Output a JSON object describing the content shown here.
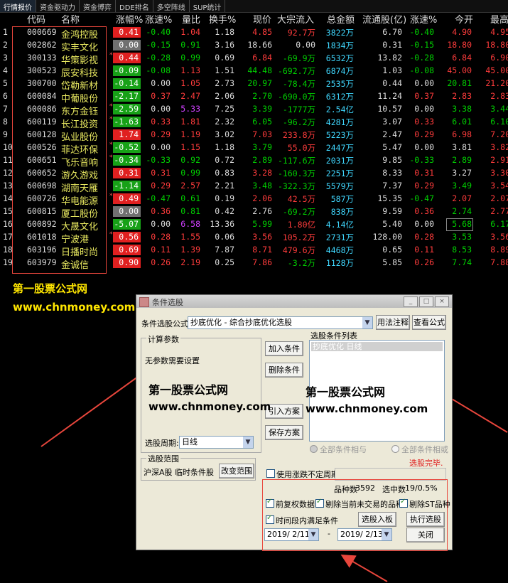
{
  "tabs": [
    "行情报价",
    "资金驱动力",
    "资金博弈",
    "DDE排名",
    "多空阵线",
    "SUP统计"
  ],
  "headers": {
    "code": "代码",
    "name": "名称",
    "pct": "涨幅%",
    "speed": "涨速%",
    "volratio": "量比",
    "turnover": "换手%",
    "price": "现价",
    "bigflow": "大宗流入",
    "amount": "总金额",
    "float": "流通股(亿)",
    "speed2": "涨速%",
    "open": "今开",
    "high": "最高"
  },
  "rows": [
    {
      "i": "1",
      "code": "000669",
      "name": "金鸿控股",
      "star": false,
      "pct": "0.41",
      "pc": "r",
      "speed": "-0.40",
      "sc": "g",
      "vol": "1.04",
      "vc": "r",
      "turn": "1.18",
      "price": "4.85",
      "prc": "r",
      "flow": "92.7万",
      "fc": "r",
      "amt": "3822万",
      "flt": "6.70",
      "sp2": "-0.40",
      "s2c": "g",
      "open": "4.90",
      "oc": "r",
      "high": "4.95",
      "hc": "r"
    },
    {
      "i": "2",
      "code": "002862",
      "name": "实丰文化",
      "star": false,
      "pct": "0.00",
      "pc": "w",
      "speed": "-0.15",
      "sc": "g",
      "vol": "0.91",
      "vc": "g",
      "turn": "3.16",
      "price": "18.66",
      "prc": "w",
      "flow": "0.00",
      "fc": "w",
      "amt": "1834万",
      "flt": "0.31",
      "sp2": "-0.15",
      "s2c": "g",
      "open": "18.80",
      "oc": "r",
      "high": "18.80",
      "hc": "r"
    },
    {
      "i": "3",
      "code": "300133",
      "name": "华策影视",
      "star": true,
      "pct": "0.44",
      "pc": "r",
      "speed": "-0.28",
      "sc": "g",
      "vol": "0.99",
      "vc": "g",
      "turn": "0.69",
      "price": "6.84",
      "prc": "r",
      "flow": "-69.9万",
      "fc": "g",
      "amt": "6532万",
      "flt": "13.82",
      "sp2": "-0.28",
      "s2c": "g",
      "open": "6.84",
      "oc": "r",
      "high": "6.90",
      "hc": "r"
    },
    {
      "i": "4",
      "code": "300523",
      "name": "辰安科技",
      "star": false,
      "pct": "-0.09",
      "pc": "g",
      "speed": "-0.08",
      "sc": "g",
      "vol": "1.13",
      "vc": "r",
      "turn": "1.51",
      "price": "44.48",
      "prc": "g",
      "flow": "-692.7万",
      "fc": "g",
      "amt": "6874万",
      "flt": "1.03",
      "sp2": "-0.08",
      "s2c": "g",
      "open": "45.00",
      "oc": "r",
      "high": "45.00",
      "hc": "r"
    },
    {
      "i": "5",
      "code": "300700",
      "name": "岱勒新材",
      "star": false,
      "pct": "-0.14",
      "pc": "g",
      "speed": "0.00",
      "sc": "w",
      "vol": "1.05",
      "vc": "r",
      "turn": "2.73",
      "price": "20.97",
      "prc": "g",
      "flow": "-78.4万",
      "fc": "g",
      "amt": "2535万",
      "flt": "0.44",
      "sp2": "0.00",
      "s2c": "w",
      "open": "20.81",
      "oc": "g",
      "high": "21.20",
      "hc": "r"
    },
    {
      "i": "6",
      "code": "600084",
      "name": "中葡股份",
      "star": false,
      "pct": "-2.17",
      "pc": "g",
      "speed": "0.37",
      "sc": "r",
      "vol": "2.47",
      "vc": "r",
      "turn": "2.06",
      "price": "2.70",
      "prc": "g",
      "flow": "-690.0万",
      "fc": "g",
      "amt": "6312万",
      "flt": "11.24",
      "sp2": "0.37",
      "s2c": "r",
      "open": "2.83",
      "oc": "r",
      "high": "2.83",
      "hc": "r"
    },
    {
      "i": "7",
      "code": "600086",
      "name": "东方金钰",
      "star": true,
      "pct": "-2.59",
      "pc": "g",
      "speed": "0.00",
      "sc": "w",
      "vol": "5.33",
      "vc": "p",
      "turn": "7.25",
      "price": "3.39",
      "prc": "g",
      "flow": "-1777万",
      "fc": "g",
      "amt": "2.54亿",
      "flt": "10.57",
      "sp2": "0.00",
      "s2c": "w",
      "open": "3.38",
      "oc": "g",
      "high": "3.44",
      "hc": "g"
    },
    {
      "i": "8",
      "code": "600119",
      "name": "长江投资",
      "star": true,
      "pct": "-1.63",
      "pc": "g",
      "speed": "0.33",
      "sc": "r",
      "vol": "1.81",
      "vc": "r",
      "turn": "2.32",
      "price": "6.05",
      "prc": "g",
      "flow": "-96.2万",
      "fc": "g",
      "amt": "4281万",
      "flt": "3.07",
      "sp2": "0.33",
      "s2c": "r",
      "open": "6.01",
      "oc": "g",
      "high": "6.10",
      "hc": "g"
    },
    {
      "i": "9",
      "code": "600128",
      "name": "弘业股份",
      "star": false,
      "pct": "1.74",
      "pc": "r",
      "speed": "0.29",
      "sc": "r",
      "vol": "1.19",
      "vc": "r",
      "turn": "3.02",
      "price": "7.03",
      "prc": "r",
      "flow": "233.8万",
      "fc": "r",
      "amt": "5223万",
      "flt": "2.47",
      "sp2": "0.29",
      "s2c": "r",
      "open": "6.98",
      "oc": "r",
      "high": "7.20",
      "hc": "r"
    },
    {
      "i": "10",
      "code": "600526",
      "name": "菲达环保",
      "star": true,
      "pct": "-0.52",
      "pc": "g",
      "speed": "0.00",
      "sc": "w",
      "vol": "1.15",
      "vc": "r",
      "turn": "1.18",
      "price": "3.79",
      "prc": "g",
      "flow": "55.0万",
      "fc": "r",
      "amt": "2447万",
      "flt": "5.47",
      "sp2": "0.00",
      "s2c": "w",
      "open": "3.81",
      "oc": "w",
      "high": "3.82",
      "hc": "r"
    },
    {
      "i": "11",
      "code": "600651",
      "name": "飞乐音响",
      "star": true,
      "pct": "-0.34",
      "pc": "g",
      "speed": "-0.33",
      "sc": "g",
      "vol": "0.92",
      "vc": "g",
      "turn": "0.72",
      "price": "2.89",
      "prc": "g",
      "flow": "-117.6万",
      "fc": "g",
      "amt": "2031万",
      "flt": "9.85",
      "sp2": "-0.33",
      "s2c": "g",
      "open": "2.89",
      "oc": "g",
      "high": "2.91",
      "hc": "r"
    },
    {
      "i": "12",
      "code": "600652",
      "name": "游久游戏",
      "star": false,
      "pct": "0.31",
      "pc": "r",
      "speed": "0.31",
      "sc": "r",
      "vol": "0.99",
      "vc": "g",
      "turn": "0.83",
      "price": "3.28",
      "prc": "r",
      "flow": "-160.3万",
      "fc": "g",
      "amt": "2251万",
      "flt": "8.33",
      "sp2": "0.31",
      "s2c": "r",
      "open": "3.27",
      "oc": "w",
      "high": "3.30",
      "hc": "r"
    },
    {
      "i": "13",
      "code": "600698",
      "name": "湖南天雁",
      "star": false,
      "pct": "-1.14",
      "pc": "g",
      "speed": "0.29",
      "sc": "r",
      "vol": "2.57",
      "vc": "r",
      "turn": "2.21",
      "price": "3.48",
      "prc": "g",
      "flow": "-322.3万",
      "fc": "g",
      "amt": "5579万",
      "flt": "7.37",
      "sp2": "0.29",
      "s2c": "r",
      "open": "3.49",
      "oc": "g",
      "high": "3.54",
      "hc": "r"
    },
    {
      "i": "14",
      "code": "600726",
      "name": "华电能源",
      "star": true,
      "pct": "0.49",
      "pc": "r",
      "speed": "-0.47",
      "sc": "g",
      "vol": "0.61",
      "vc": "g",
      "turn": "0.19",
      "price": "2.06",
      "prc": "r",
      "flow": "42.5万",
      "fc": "r",
      "amt": "587万",
      "flt": "15.35",
      "sp2": "-0.47",
      "s2c": "g",
      "open": "2.07",
      "oc": "r",
      "high": "2.07",
      "hc": "r"
    },
    {
      "i": "15",
      "code": "600815",
      "name": "厦工股份",
      "star": false,
      "pct": "0.00",
      "pc": "w",
      "speed": "0.36",
      "sc": "r",
      "vol": "0.81",
      "vc": "g",
      "turn": "0.42",
      "price": "2.76",
      "prc": "w",
      "flow": "-69.2万",
      "fc": "g",
      "amt": "838万",
      "flt": "9.59",
      "sp2": "0.36",
      "s2c": "r",
      "open": "2.74",
      "oc": "g",
      "high": "2.77",
      "hc": "r"
    },
    {
      "i": "16",
      "code": "600892",
      "name": "大晟文化",
      "star": false,
      "pct": "-5.07",
      "pc": "g",
      "speed": "0.00",
      "sc": "w",
      "vol": "6.58",
      "vc": "p",
      "turn": "13.36",
      "price": "5.99",
      "prc": "g",
      "flow": "1.80亿",
      "fc": "r",
      "amt": "4.14亿",
      "flt": "5.40",
      "sp2": "0.00",
      "s2c": "w",
      "open": "5.68",
      "oc": "g",
      "high": "6.17",
      "hc": "g"
    },
    {
      "i": "17",
      "code": "601018",
      "name": "宁波港",
      "star": true,
      "pct": "0.56",
      "pc": "r",
      "speed": "0.28",
      "sc": "r",
      "vol": "1.55",
      "vc": "r",
      "turn": "0.06",
      "price": "3.56",
      "prc": "r",
      "flow": "105.2万",
      "fc": "r",
      "amt": "2731万",
      "flt": "128.00",
      "sp2": "0.28",
      "s2c": "r",
      "open": "3.53",
      "oc": "g",
      "high": "3.56",
      "hc": "r"
    },
    {
      "i": "18",
      "code": "603196",
      "name": "日播时尚",
      "star": false,
      "pct": "0.69",
      "pc": "r",
      "speed": "0.11",
      "sc": "r",
      "vol": "1.39",
      "vc": "r",
      "turn": "7.87",
      "price": "8.71",
      "prc": "r",
      "flow": "479.6万",
      "fc": "r",
      "amt": "4468万",
      "flt": "0.65",
      "sp2": "0.11",
      "s2c": "r",
      "open": "8.53",
      "oc": "g",
      "high": "8.89",
      "hc": "r"
    },
    {
      "i": "19",
      "code": "603979",
      "name": "金诚信",
      "star": false,
      "pct": "0.90",
      "pc": "r",
      "speed": "0.26",
      "sc": "r",
      "vol": "2.19",
      "vc": "r",
      "turn": "0.25",
      "price": "7.86",
      "prc": "r",
      "flow": "-3.2万",
      "fc": "g",
      "amt": "1128万",
      "flt": "5.85",
      "sp2": "0.26",
      "s2c": "r",
      "open": "7.74",
      "oc": "g",
      "high": "7.88",
      "hc": "r"
    }
  ],
  "watermark": {
    "cn": "第一股票公式网",
    "url": "www.chnmoney.com"
  },
  "dialog": {
    "title": "条件选股",
    "formula_label": "条件选股公式",
    "formula_value": "抄底优化    - 综合抄底优化选股",
    "btn_usage": "用法注释",
    "btn_view": "查看公式",
    "params_title": "计算参数",
    "params_text": "无参数需要设置",
    "list_title": "选股条件列表",
    "list_item": "抄底优化  日线",
    "btn_add": "加入条件",
    "btn_delete": "删除条件",
    "btn_import": "引入方案",
    "btn_save": "保存方案",
    "period_label": "选股周期:",
    "period_value": "日线",
    "radio_and": "全部条件相与",
    "radio_or": "全部条件相或",
    "status": "选股完毕.",
    "range_title": "选股范围",
    "range_text": "沪深A股 临时条件股",
    "btn_range": "改变范围",
    "chk_uncertain": "使用涨跌不定周期",
    "count_label": "品种数",
    "count_value": "3592",
    "selected_label": "选中数",
    "selected_value": "19/0.5%",
    "chk_pre": "前复权数据",
    "chk_exclude": "剔除当前未交易的品种",
    "chk_st": "剔除ST品种",
    "chk_period": "时间段内满足条件",
    "btn_toblock": "选股入板块",
    "btn_run": "执行选股",
    "btn_close": "关闭",
    "date_from": "2019/ 2/11",
    "date_to": "2019/ 2/13",
    "dash": "-",
    "win_btns": [
      "_",
      "□",
      "×"
    ]
  },
  "colors": {
    "up": "#ff3c3c",
    "down": "#00d000",
    "flat": "#dddddd",
    "name": "#e8e860",
    "annotation": "#e8463c"
  }
}
